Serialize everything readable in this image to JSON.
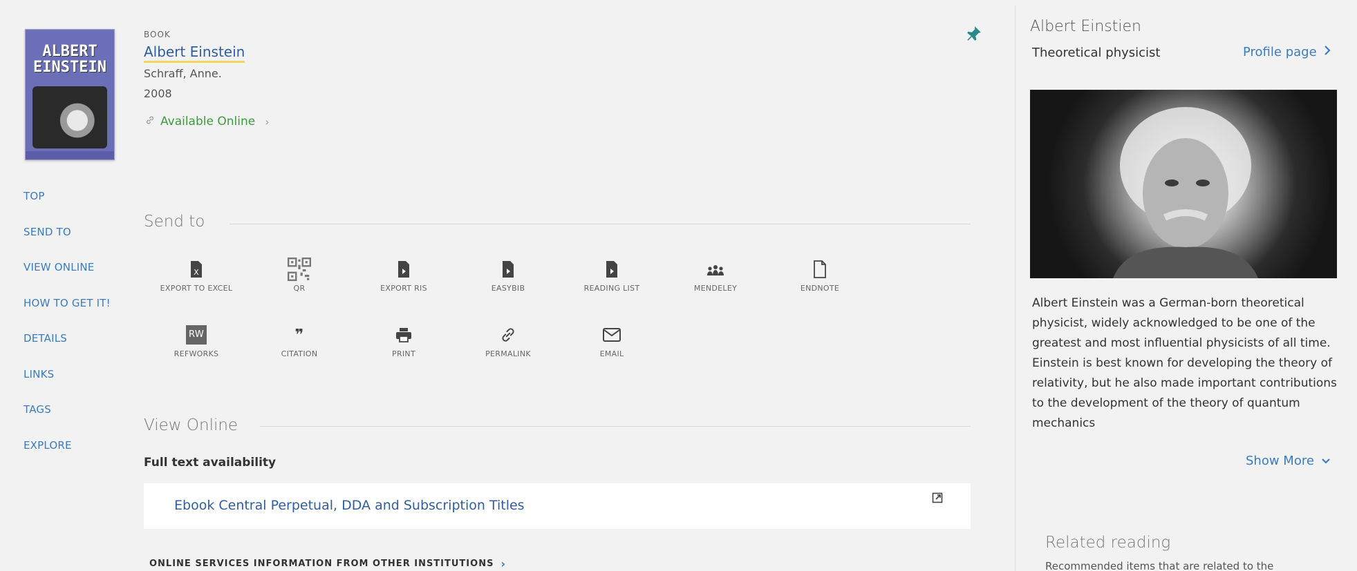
{
  "record": {
    "cover_text": "ALBERT\nEINSTEIN",
    "type": "BOOK",
    "title": "Albert Einstein",
    "author": "Schraff, Anne.",
    "year": "2008",
    "availability": "Available Online",
    "availability_color": "#3e9a3e"
  },
  "left_nav": [
    "TOP",
    "SEND TO",
    "VIEW ONLINE",
    "HOW TO GET IT!",
    "DETAILS",
    "LINKS",
    "TAGS",
    "EXPLORE"
  ],
  "send_to": {
    "heading": "Send to",
    "items": [
      {
        "label": "EXPORT TO EXCEL",
        "icon": "excel-icon"
      },
      {
        "label": "QR",
        "icon": "qr-icon"
      },
      {
        "label": "EXPORT RIS",
        "icon": "ris-file-icon"
      },
      {
        "label": "EASYBIB",
        "icon": "easybib-file-icon"
      },
      {
        "label": "READING LIST",
        "icon": "reading-list-file-icon"
      },
      {
        "label": "MENDELEY",
        "icon": "mendeley-icon"
      },
      {
        "label": "ENDNOTE",
        "icon": "endnote-file-icon"
      },
      {
        "label": "REFWORKS",
        "icon": "refworks-icon",
        "badge": "RW"
      },
      {
        "label": "CITATION",
        "icon": "quote-icon",
        "glyph": "❞"
      },
      {
        "label": "PRINT",
        "icon": "printer-icon"
      },
      {
        "label": "PERMALINK",
        "icon": "link-icon"
      },
      {
        "label": "EMAIL",
        "icon": "envelope-icon"
      }
    ]
  },
  "view_online": {
    "heading": "View Online",
    "full_text_label": "Full text availability",
    "provider": "Ebook Central Perpetual, DDA and Subscription Titles",
    "other_institutions": "ONLINE SERVICES INFORMATION FROM OTHER INSTITUTIONS"
  },
  "knowledge_panel": {
    "name": "Albert Einstien",
    "role": "Theoretical physicist",
    "profile_link": "Profile page",
    "description": "Albert Einstein was a German-born theoretical physicist, widely acknowledged to be one of the greatest and most influential physicists of all time. Einstein is best known for developing the theory of relativity, but he also made important contributions to the development of the theory of quantum mechanics",
    "show_more": "Show More",
    "related_heading": "Related reading",
    "related_sub": "Recommended items that are related to the"
  },
  "colors": {
    "background": "#f2f2f2",
    "link": "#3a7cbf",
    "title_link": "#2f5ea0",
    "title_underline": "#f0d55c",
    "pin": "#2a8a8a"
  }
}
